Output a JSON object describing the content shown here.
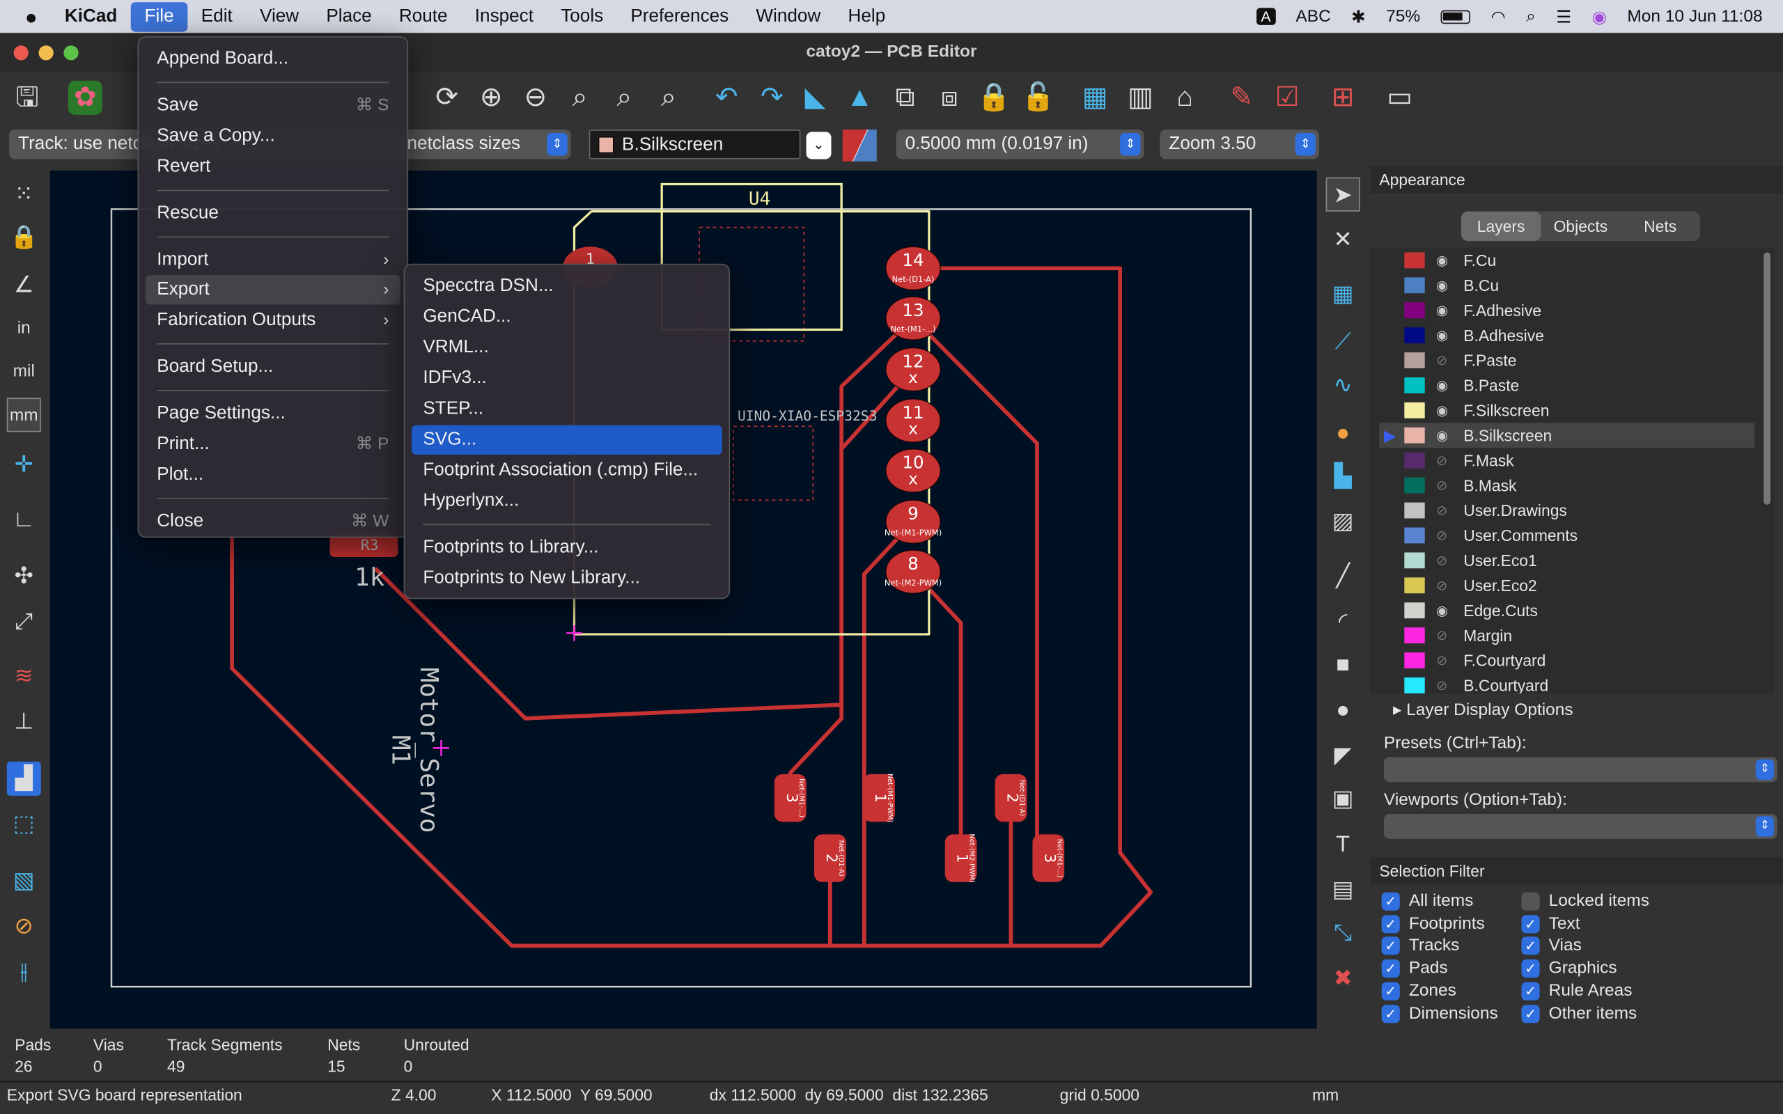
{
  "menubar": {
    "apple": "",
    "app": "KiCad",
    "items": [
      "File",
      "Edit",
      "View",
      "Place",
      "Route",
      "Inspect",
      "Tools",
      "Preferences",
      "Window",
      "Help"
    ],
    "input_source": "ABC",
    "battery": "75%",
    "datetime": "Mon 10 Jun  11:08"
  },
  "window": {
    "title": "catoy2 — PCB Editor"
  },
  "toolbar2": {
    "track": "Track: use netclass sizes",
    "via": "netclass sizes",
    "layer": "B.Silkscreen",
    "layer_color": "#e8b4a8",
    "grid": "0.5000 mm (0.0197 in)",
    "zoom": "Zoom 3.50"
  },
  "file_menu": {
    "items": [
      {
        "label": "Append Board..."
      },
      {
        "sep": true
      },
      {
        "label": "Save",
        "shortcut": "⌘ S"
      },
      {
        "label": "Save a Copy..."
      },
      {
        "label": "Revert"
      },
      {
        "sep": true
      },
      {
        "label": "Rescue"
      },
      {
        "sep": true
      },
      {
        "label": "Import",
        "arrow": true
      },
      {
        "label": "Export",
        "arrow": true,
        "open": true
      },
      {
        "label": "Fabrication Outputs",
        "arrow": true
      },
      {
        "sep": true
      },
      {
        "label": "Board Setup..."
      },
      {
        "sep": true
      },
      {
        "label": "Page Settings..."
      },
      {
        "label": "Print...",
        "shortcut": "⌘ P"
      },
      {
        "label": "Plot..."
      },
      {
        "sep": true
      },
      {
        "label": "Close",
        "shortcut": "⌘ W"
      }
    ]
  },
  "export_menu": {
    "items": [
      {
        "label": "Specctra DSN..."
      },
      {
        "label": "GenCAD..."
      },
      {
        "label": "VRML..."
      },
      {
        "label": "IDFv3..."
      },
      {
        "label": "STEP..."
      },
      {
        "label": "SVG...",
        "highlighted": true
      },
      {
        "label": "Footprint Association (.cmp) File..."
      },
      {
        "label": "Hyperlynx..."
      },
      {
        "sep": true
      },
      {
        "label": "Footprints to Library..."
      },
      {
        "label": "Footprints to New Library..."
      }
    ]
  },
  "left_toolbar": {
    "units": [
      "in",
      "mil",
      "mm"
    ]
  },
  "pcb": {
    "ref_u4": "U4",
    "ref_u4_value": "UINO-XIAO-ESP32S3",
    "motor_ref": "M1",
    "motor_value": "Motor_Servo",
    "resistor_partial": "1k",
    "resistor_ref_partial": "R3",
    "header_pads": [
      {
        "num": "14",
        "net": "Net-(D1-A)"
      },
      {
        "num": "13",
        "net": "Net-(M1-...)"
      },
      {
        "num": "12",
        "net": "x"
      },
      {
        "num": "11",
        "net": "x"
      },
      {
        "num": "10",
        "net": "x"
      },
      {
        "num": "9",
        "net": "Net-(M1-PWM)"
      },
      {
        "num": "8",
        "net": "Net-(M2-PWM)"
      }
    ],
    "left_pad_partial": "1",
    "bottom_pads": [
      {
        "num": "3",
        "net": "Net-(M1-...)"
      },
      {
        "num": "1",
        "net": "Net-(M1-PWM)"
      },
      {
        "num": "2",
        "net": "Net-(D1-A)"
      },
      {
        "num": "2",
        "net": "Net-(D1-A)"
      },
      {
        "num": "1",
        "net": "Net-(M2-PWM)"
      },
      {
        "num": "3",
        "net": "Net-(M1-...)"
      }
    ],
    "colors": {
      "copper": "#c83232",
      "silk": "#f2eda1",
      "edge": "#d0d2cd",
      "bg": "#001023"
    }
  },
  "appearance": {
    "title": "Appearance",
    "tabs": [
      "Layers",
      "Objects",
      "Nets"
    ],
    "layers": [
      {
        "name": "F.Cu",
        "color": "#c83434",
        "visible": true
      },
      {
        "name": "B.Cu",
        "color": "#4d7fc4",
        "visible": true
      },
      {
        "name": "F.Adhesive",
        "color": "#84007f",
        "visible": true
      },
      {
        "name": "B.Adhesive",
        "color": "#000a84",
        "visible": true
      },
      {
        "name": "F.Paste",
        "color": "#b4a09a",
        "visible": false
      },
      {
        "name": "B.Paste",
        "color": "#00c2c2",
        "visible": true
      },
      {
        "name": "F.Silkscreen",
        "color": "#f2eda1",
        "visible": true
      },
      {
        "name": "B.Silkscreen",
        "color": "#e8b4a8",
        "visible": true,
        "active": true
      },
      {
        "name": "F.Mask",
        "color": "#5a2a6e",
        "visible": false
      },
      {
        "name": "B.Mask",
        "color": "#026e5e",
        "visible": false
      },
      {
        "name": "User.Drawings",
        "color": "#c2c2c2",
        "visible": false
      },
      {
        "name": "User.Comments",
        "color": "#5984d2",
        "visible": false
      },
      {
        "name": "User.Eco1",
        "color": "#b4dbd2",
        "visible": false
      },
      {
        "name": "User.Eco2",
        "color": "#d8c852",
        "visible": false
      },
      {
        "name": "Edge.Cuts",
        "color": "#d0d2cd",
        "visible": true
      },
      {
        "name": "Margin",
        "color": "#ff26e2",
        "visible": false
      },
      {
        "name": "F.Courtyard",
        "color": "#ff26e2",
        "visible": false
      },
      {
        "name": "B.Courtyard",
        "color": "#26e9ff",
        "visible": false
      }
    ],
    "layer_display_options": "Layer Display Options",
    "presets_label": "Presets (Ctrl+Tab):",
    "viewports_label": "Viewports (Option+Tab):"
  },
  "selection_filter": {
    "title": "Selection Filter",
    "items": [
      {
        "label": "All items",
        "checked": true
      },
      {
        "label": "Locked items",
        "checked": false
      },
      {
        "label": "Footprints",
        "checked": true
      },
      {
        "label": "Text",
        "checked": true
      },
      {
        "label": "Tracks",
        "checked": true
      },
      {
        "label": "Vias",
        "checked": true
      },
      {
        "label": "Pads",
        "checked": true
      },
      {
        "label": "Graphics",
        "checked": true
      },
      {
        "label": "Zones",
        "checked": true
      },
      {
        "label": "Rule Areas",
        "checked": true
      },
      {
        "label": "Dimensions",
        "checked": true
      },
      {
        "label": "Other items",
        "checked": true
      }
    ]
  },
  "stats": [
    {
      "label": "Pads",
      "value": "26"
    },
    {
      "label": "Vias",
      "value": "0"
    },
    {
      "label": "Track Segments",
      "value": "49"
    },
    {
      "label": "Nets",
      "value": "15"
    },
    {
      "label": "Unrouted",
      "value": "0"
    }
  ],
  "statusbar": {
    "message": "Export SVG board representation",
    "zoom": "Z 4.00",
    "xy": "X 112.5000  Y 69.5000",
    "delta": "dx 112.5000  dy 69.5000  dist 132.2365",
    "grid": "grid 0.5000",
    "units": "mm"
  }
}
